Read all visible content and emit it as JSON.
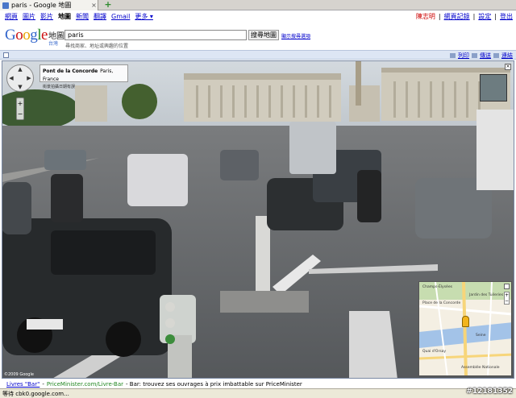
{
  "browser": {
    "tab_title": "paris - Google 地圖",
    "tab_close": "×",
    "new_tab": "+"
  },
  "gbar": {
    "links": [
      "網頁",
      "圖片",
      "影片",
      "地圖",
      "新聞",
      "翻譯",
      "Gmail",
      "更多 ▾"
    ],
    "current_index": 3,
    "user": "陳志明",
    "history": "網頁記錄",
    "settings": "設定",
    "signout": "登出"
  },
  "header": {
    "logo_letters": [
      "G",
      "o",
      "o",
      "g",
      "l",
      "e"
    ],
    "product": "地圖",
    "region": "台灣",
    "search_value": "paris",
    "search_button": "搜尋地圖",
    "options_link": "顯示搜尋選項",
    "hint": "尋找商家、地址或興趣的位置"
  },
  "toolbar": {
    "print": "列印",
    "email": "傳送",
    "link": "連結"
  },
  "streetview": {
    "place_name": "Pont de la Concorde",
    "city": "Paris, France",
    "subtitle": "街景拍攝日期有誤",
    "copyright": "©2009 Google",
    "close": "×",
    "zoom_in": "+",
    "zoom_out": "−",
    "nav_arrows": [
      "▲",
      "▼",
      "◀",
      "▶"
    ]
  },
  "minimap": {
    "labels": [
      "Place de la Concorde",
      "Champs-Élysées",
      "Quai d'Orsay",
      "Assemblée Nationale",
      "Jardin des Tuileries",
      "Seine"
    ],
    "zoom_in": "+",
    "zoom_out": "−"
  },
  "ad": {
    "title": "Livres \"Bar\"",
    "separator": "-",
    "url": "PriceMinister.com/Livre-Bar",
    "text": "- Bar: trouvez ses ouvrages à prix imbattable sur PriceMinister"
  },
  "status": {
    "text": "等待 cbk0.google.com..."
  },
  "watermark": "#12181352",
  "colors": {
    "link": "#0000cc",
    "sky": "#c9d0d6",
    "road": "#5f6266",
    "map_bg": "#f4efe3",
    "river": "#a3c3e8"
  }
}
